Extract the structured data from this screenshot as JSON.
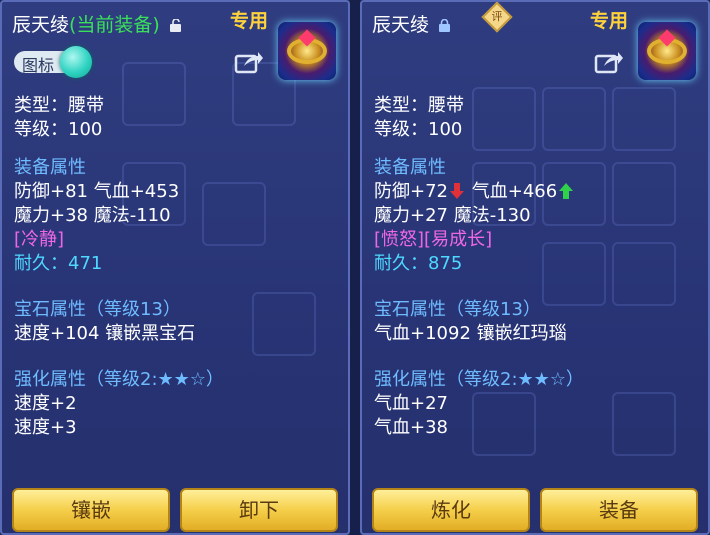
{
  "left": {
    "name": "辰天绫",
    "current_equipped": "(当前装备)",
    "tag": "专用",
    "toggle_label": "图标",
    "stats": {
      "type": "类型：腰带",
      "level": "等级：100",
      "equip_header": "装备属性",
      "line1": "防御+81 气血+453",
      "line2": "魔力+38 魔法-110",
      "special": "[冷静]",
      "durability": "耐久：471",
      "gem_header": "宝石属性（等级13）",
      "gem_line": "速度+104 镶嵌黑宝石",
      "enhance_header": "强化属性（等级2:★★☆）",
      "enhance1": "速度+2",
      "enhance2": "速度+3"
    },
    "buttons": {
      "b1": "镶嵌",
      "b2": "卸下"
    }
  },
  "right": {
    "name": "辰天绫",
    "ping": "评",
    "tag": "专用",
    "stats": {
      "type": "类型：腰带",
      "level": "等级：100",
      "equip_header": "装备属性",
      "line1a": "防御+72",
      "line1b": "气血+466",
      "line2": "魔力+27 魔法-130",
      "special": "[愤怒][易成长]",
      "durability": "耐久：875",
      "gem_header": "宝石属性（等级13）",
      "gem_line": "气血+1092 镶嵌红玛瑙",
      "enhance_header": "强化属性（等级2:★★☆）",
      "enhance1": "气血+27",
      "enhance2": "气血+38"
    },
    "buttons": {
      "b1": "炼化",
      "b2": "装备"
    }
  },
  "colors": {
    "title_green": "#39e05a",
    "section_blue": "#6ebbff",
    "special_pink": "#f067e6",
    "durability_cyan": "#4fd9ff",
    "tag_gold": "#ffd23c",
    "arrow_down": "#e0303a",
    "arrow_up": "#2fd04a"
  },
  "icons": [
    "unlock-icon",
    "lock-icon",
    "share-icon",
    "belt-item-icon",
    "arrow-down-icon",
    "arrow-up-icon"
  ]
}
